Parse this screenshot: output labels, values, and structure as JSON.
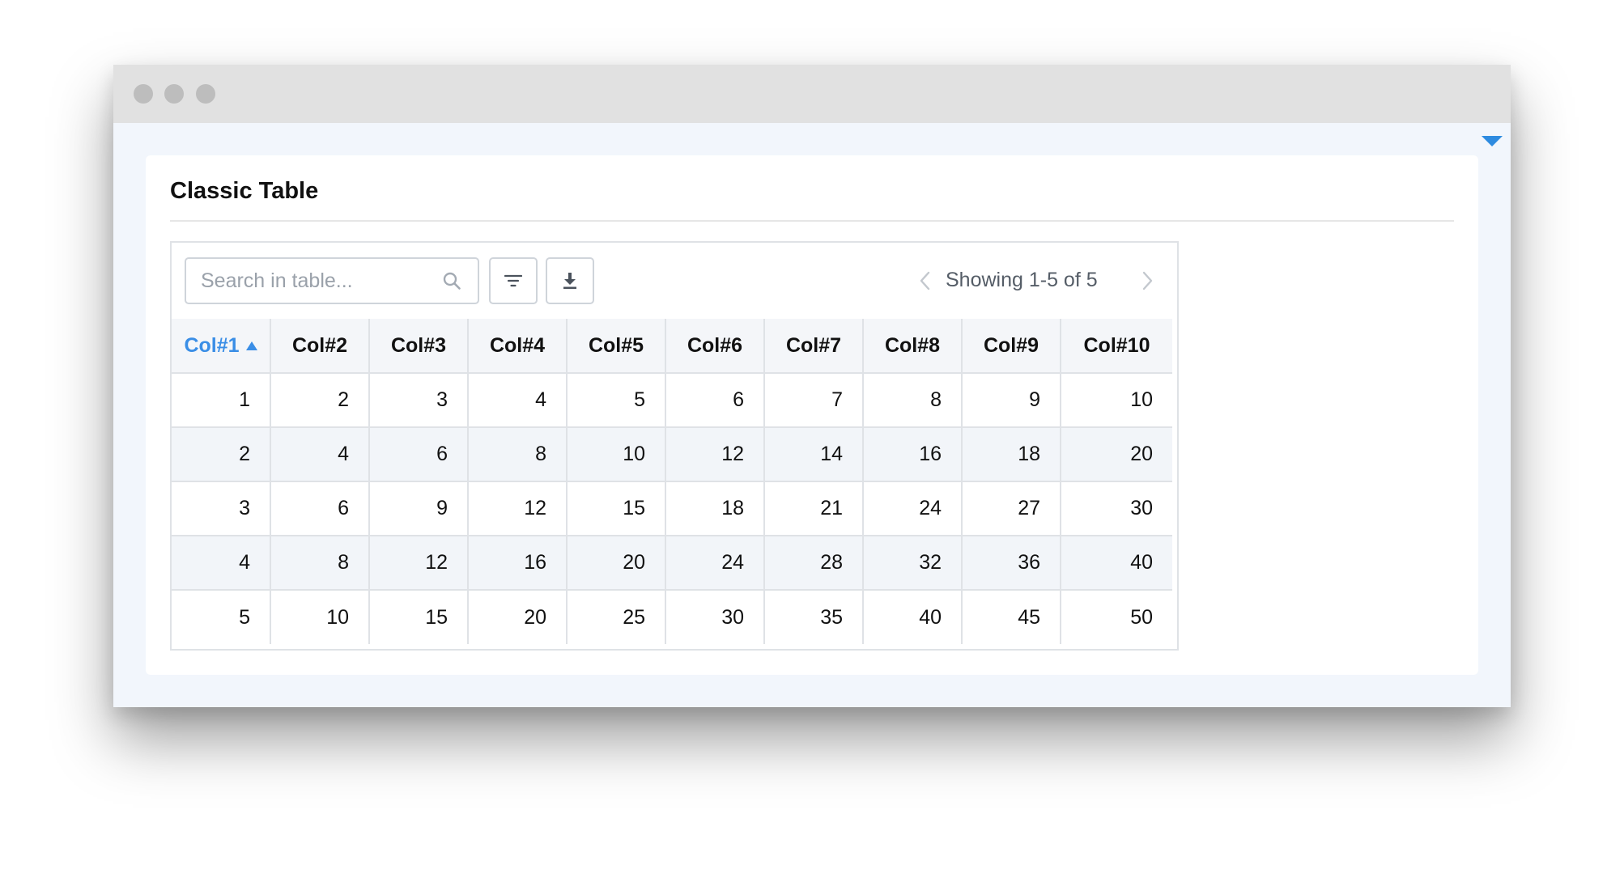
{
  "card": {
    "title": "Classic Table"
  },
  "toolbar": {
    "search_placeholder": "Search in table...",
    "filter_icon": "filter-icon",
    "download_icon": "download-icon"
  },
  "pager": {
    "info": "Showing 1-5 of 5"
  },
  "table": {
    "sorted_column": "Col#1",
    "sort_direction": "ascending",
    "headers": [
      "Col#1",
      "Col#2",
      "Col#3",
      "Col#4",
      "Col#5",
      "Col#6",
      "Col#7",
      "Col#8",
      "Col#9",
      "Col#10"
    ],
    "rows": [
      [
        "1",
        "2",
        "3",
        "4",
        "5",
        "6",
        "7",
        "8",
        "9",
        "10"
      ],
      [
        "2",
        "4",
        "6",
        "8",
        "10",
        "12",
        "14",
        "16",
        "18",
        "20"
      ],
      [
        "3",
        "6",
        "9",
        "12",
        "15",
        "18",
        "21",
        "24",
        "27",
        "30"
      ],
      [
        "4",
        "8",
        "12",
        "16",
        "20",
        "24",
        "28",
        "32",
        "36",
        "40"
      ],
      [
        "5",
        "10",
        "15",
        "20",
        "25",
        "30",
        "35",
        "40",
        "45",
        "50"
      ]
    ]
  },
  "colors": {
    "accent": "#3a8ee6",
    "toggle": "#2e8be0",
    "row_stripe": "#f2f5f9",
    "page_bg": "#f2f6fc"
  }
}
